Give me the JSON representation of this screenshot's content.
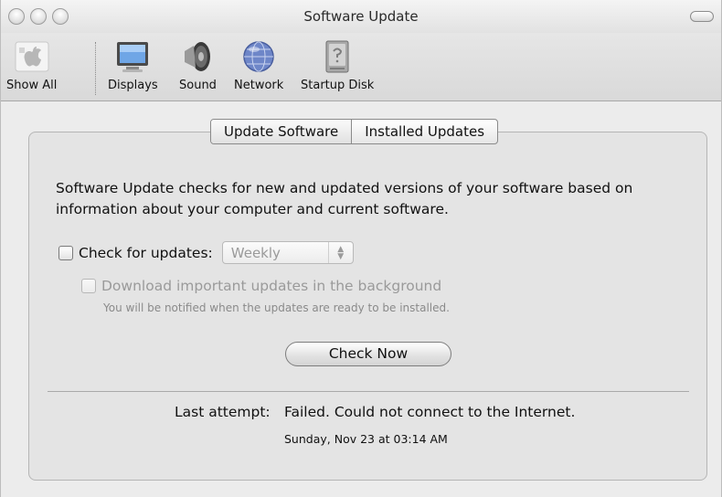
{
  "window": {
    "title": "Software Update"
  },
  "toolbar": {
    "items": [
      {
        "label": "Show All",
        "icon": "apple-icon"
      },
      {
        "label": "Displays",
        "icon": "display-icon"
      },
      {
        "label": "Sound",
        "icon": "speaker-icon"
      },
      {
        "label": "Network",
        "icon": "network-globe-icon"
      },
      {
        "label": "Startup Disk",
        "icon": "hard-disk-icon"
      }
    ]
  },
  "tabs": [
    {
      "label": "Update Software",
      "selected": true
    },
    {
      "label": "Installed Updates",
      "selected": false
    }
  ],
  "main": {
    "description": "Software Update checks for new and updated versions of your software based on information about your computer and current software.",
    "check_for_updates": {
      "label": "Check for updates:",
      "checked": false
    },
    "frequency_select": {
      "value": "Weekly"
    },
    "download_background": {
      "label": "Download important updates in the background",
      "checked": false,
      "enabled": false
    },
    "notify_hint": "You will be notified when the updates are ready to be installed.",
    "check_now_label": "Check Now"
  },
  "status": {
    "label": "Last attempt:",
    "value": "Failed. Could not connect to the Internet.",
    "date": "Sunday, Nov 23 at 03:14 AM"
  }
}
